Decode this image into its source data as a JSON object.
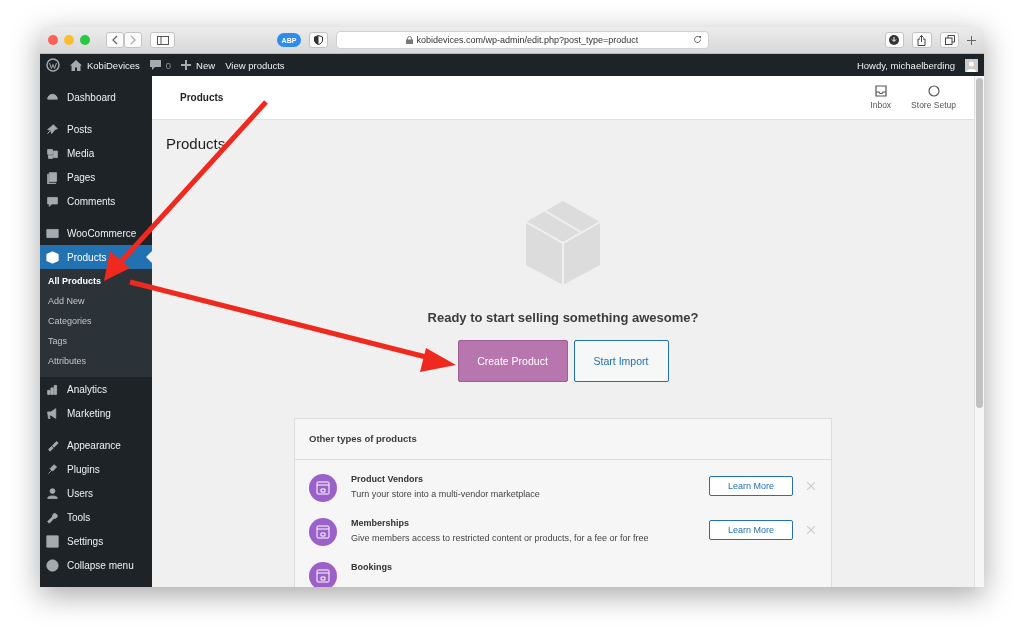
{
  "browser": {
    "url": "kobidevices.com/wp-admin/edit.php?post_type=product",
    "extension_badge": "ABP"
  },
  "admin_bar": {
    "site": "KobiDevices",
    "comments": "0",
    "new": "New",
    "view": "View products",
    "greeting": "Howdy, michaelberding"
  },
  "sidebar": {
    "groups": [
      [
        {
          "label": "Dashboard",
          "selected": false
        }
      ],
      [
        {
          "label": "Posts",
          "selected": false
        },
        {
          "label": "Media",
          "selected": false
        },
        {
          "label": "Pages",
          "selected": false
        },
        {
          "label": "Comments",
          "selected": false
        }
      ],
      [
        {
          "label": "WooCommerce",
          "selected": false
        },
        {
          "label": "Products",
          "selected": true,
          "children": [
            {
              "label": "All Products",
              "selected": true
            },
            {
              "label": "Add New",
              "selected": false
            },
            {
              "label": "Categories",
              "selected": false
            },
            {
              "label": "Tags",
              "selected": false
            },
            {
              "label": "Attributes",
              "selected": false
            }
          ]
        },
        {
          "label": "Analytics",
          "selected": false
        },
        {
          "label": "Marketing",
          "selected": false
        }
      ],
      [
        {
          "label": "Appearance",
          "selected": false
        },
        {
          "label": "Plugins",
          "selected": false
        },
        {
          "label": "Users",
          "selected": false
        },
        {
          "label": "Tools",
          "selected": false
        },
        {
          "label": "Settings",
          "selected": false
        },
        {
          "label": "Collapse menu",
          "selected": false
        }
      ]
    ]
  },
  "header": {
    "title": "Products",
    "actions": [
      "Inbox",
      "Store Setup"
    ]
  },
  "page_title": "Products",
  "empty_state": {
    "message": "Ready to start selling something awesome?",
    "buttons": [
      {
        "label": "Create Product",
        "kind": "primary"
      },
      {
        "label": "Start Import",
        "kind": "secondary"
      }
    ]
  },
  "other_types": {
    "title": "Other types of products",
    "items": [
      {
        "name": "Product Vendors",
        "description": "Turn your store into a multi-vendor marketplace",
        "button": "Learn More"
      },
      {
        "name": "Memberships",
        "description": "Give members access to restricted content or products, for a fee or for free",
        "button": "Learn More"
      },
      {
        "name": "Bookings"
      }
    ]
  }
}
